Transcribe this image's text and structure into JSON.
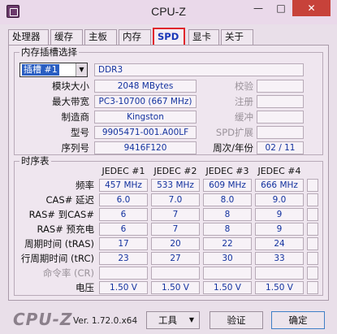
{
  "window": {
    "title": "CPU-Z",
    "min_glyph": "—",
    "max_glyph": "□",
    "close_glyph": "✕"
  },
  "tabs": [
    {
      "label": "处理器",
      "active": false
    },
    {
      "label": "缓存",
      "active": false
    },
    {
      "label": "主板",
      "active": false
    },
    {
      "label": "内存",
      "active": false
    },
    {
      "label": "SPD",
      "active": true
    },
    {
      "label": "显卡",
      "active": false
    },
    {
      "label": "关于",
      "active": false
    }
  ],
  "slot_group": {
    "legend": "内存插槽选择",
    "slot_select": "插槽 #1",
    "memory_type": "DDR3",
    "labels": {
      "module_size": "模块大小",
      "max_bandwidth": "最大带宽",
      "manufacturer": "制造商",
      "part_number": "型号",
      "serial_number": "序列号",
      "correction": "校验",
      "registered": "注册",
      "buffered": "缓冲",
      "spd_ext": "SPD扩展",
      "week_year": "周次/年份"
    },
    "values": {
      "module_size": "2048 MBytes",
      "max_bandwidth": "PC3-10700 (667 MHz)",
      "manufacturer": "Kingston",
      "part_number": "9905471-001.A00LF",
      "serial_number": "9416F120",
      "correction": "",
      "registered": "",
      "buffered": "",
      "spd_ext": "",
      "week_year": "02 / 11"
    }
  },
  "timings": {
    "legend": "时序表",
    "columns": [
      "JEDEC #1",
      "JEDEC #2",
      "JEDEC #3",
      "JEDEC #4",
      ""
    ],
    "rows": [
      {
        "label": "频率",
        "dim": false,
        "values": [
          "457 MHz",
          "533 MHz",
          "609 MHz",
          "666 MHz",
          ""
        ]
      },
      {
        "label": "CAS# 延迟",
        "dim": false,
        "values": [
          "6.0",
          "7.0",
          "8.0",
          "9.0",
          ""
        ]
      },
      {
        "label": "RAS# 到CAS#",
        "dim": false,
        "values": [
          "6",
          "7",
          "8",
          "9",
          ""
        ]
      },
      {
        "label": "RAS# 预充电",
        "dim": false,
        "values": [
          "6",
          "7",
          "8",
          "9",
          ""
        ]
      },
      {
        "label": "周期时间 (tRAS)",
        "dim": false,
        "values": [
          "17",
          "20",
          "22",
          "24",
          ""
        ]
      },
      {
        "label": "行周期时间 (tRC)",
        "dim": false,
        "values": [
          "23",
          "27",
          "30",
          "33",
          ""
        ]
      },
      {
        "label": "命令率 (CR)",
        "dim": true,
        "values": [
          "",
          "",
          "",
          "",
          ""
        ]
      },
      {
        "label": "电压",
        "dim": false,
        "values": [
          "1.50 V",
          "1.50 V",
          "1.50 V",
          "1.50 V",
          ""
        ]
      }
    ]
  },
  "footer": {
    "brand": "CPU-Z",
    "version": "Ver. 1.72.0.x64",
    "tools_button": "工具",
    "tools_arrow": "▼",
    "validate_button": "验证",
    "ok_button": "确定"
  },
  "colors": {
    "active_tab_border": "#e0262c",
    "value_text": "#13329f",
    "close_button": "#c7423a"
  }
}
